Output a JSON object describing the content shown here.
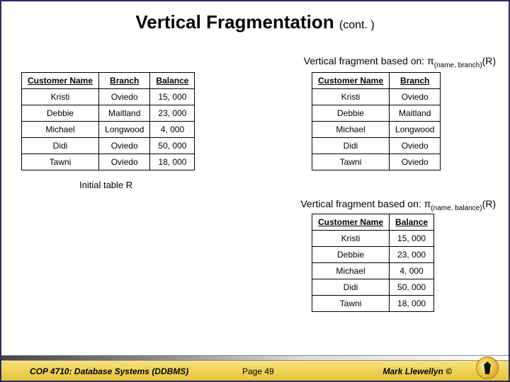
{
  "title": "Vertical Fragmentation",
  "title_cont": "(cont. )",
  "fragment_caption_1_prefix": "Vertical fragment based on: π",
  "fragment_caption_1_sub": "(name, branch)",
  "fragment_caption_1_suffix": "(R)",
  "fragment_caption_2_prefix": "Vertical fragment based on: π",
  "fragment_caption_2_sub": "(name, balance)",
  "fragment_caption_2_suffix": "(R)",
  "initial_caption": "Initial table R",
  "table_left": {
    "headers": [
      "Customer Name",
      "Branch",
      "Balance"
    ],
    "rows": [
      [
        "Kristi",
        "Oviedo",
        "15, 000"
      ],
      [
        "Debbie",
        "Maitland",
        "23, 000"
      ],
      [
        "Michael",
        "Longwood",
        "4, 000"
      ],
      [
        "Didi",
        "Oviedo",
        "50, 000"
      ],
      [
        "Tawni",
        "Oviedo",
        "18, 000"
      ]
    ]
  },
  "table_right_top": {
    "headers": [
      "Customer Name",
      "Branch"
    ],
    "rows": [
      [
        "Kristi",
        "Oviedo"
      ],
      [
        "Debbie",
        "Maitland"
      ],
      [
        "Michael",
        "Longwood"
      ],
      [
        "Didi",
        "Oviedo"
      ],
      [
        "Tawni",
        "Oviedo"
      ]
    ]
  },
  "table_right_bot": {
    "headers": [
      "Customer Name",
      "Balance"
    ],
    "rows": [
      [
        "Kristi",
        "15, 000"
      ],
      [
        "Debbie",
        "23, 000"
      ],
      [
        "Michael",
        "4, 000"
      ],
      [
        "Didi",
        "50, 000"
      ],
      [
        "Tawni",
        "18, 000"
      ]
    ]
  },
  "footer": {
    "left": "COP 4710: Database Systems  (DDBMS)",
    "mid": "Page 49",
    "right": "Mark Llewellyn ©"
  },
  "chart_data": {
    "type": "table",
    "tables": [
      {
        "name": "Initial table R",
        "columns": [
          "Customer Name",
          "Branch",
          "Balance"
        ],
        "rows": [
          [
            "Kristi",
            "Oviedo",
            15000
          ],
          [
            "Debbie",
            "Maitland",
            23000
          ],
          [
            "Michael",
            "Longwood",
            4000
          ],
          [
            "Didi",
            "Oviedo",
            50000
          ],
          [
            "Tawni",
            "Oviedo",
            18000
          ]
        ]
      },
      {
        "name": "π(name, branch)(R)",
        "columns": [
          "Customer Name",
          "Branch"
        ],
        "rows": [
          [
            "Kristi",
            "Oviedo"
          ],
          [
            "Debbie",
            "Maitland"
          ],
          [
            "Michael",
            "Longwood"
          ],
          [
            "Didi",
            "Oviedo"
          ],
          [
            "Tawni",
            "Oviedo"
          ]
        ]
      },
      {
        "name": "π(name, balance)(R)",
        "columns": [
          "Customer Name",
          "Balance"
        ],
        "rows": [
          [
            "Kristi",
            15000
          ],
          [
            "Debbie",
            23000
          ],
          [
            "Michael",
            4000
          ],
          [
            "Didi",
            50000
          ],
          [
            "Tawni",
            18000
          ]
        ]
      }
    ]
  }
}
